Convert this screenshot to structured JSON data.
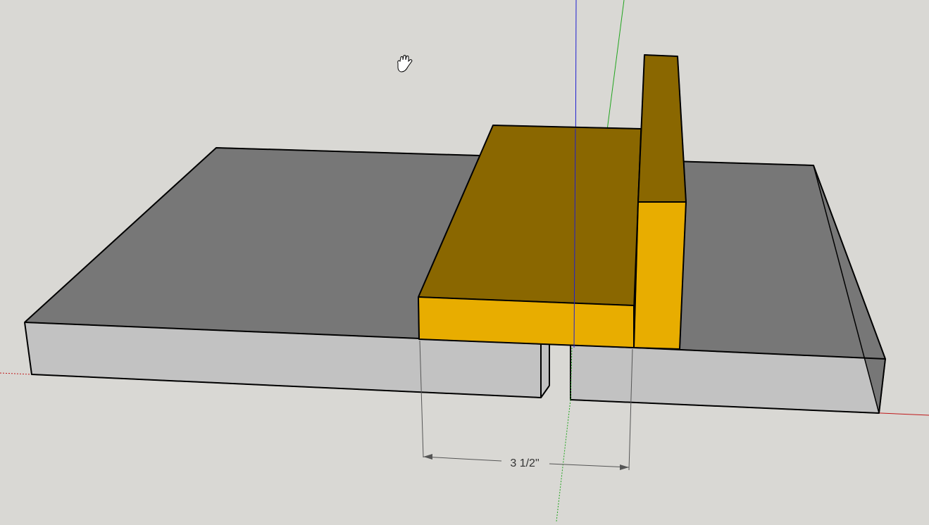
{
  "app": {
    "type": "3d-modeling-viewport"
  },
  "viewport": {
    "background_color": "#d9d8d4",
    "active_tool_icon": "pan-hand-icon"
  },
  "axes": {
    "red_color": "#c0191b",
    "green_color": "#22a51f",
    "blue_color": "#1f1fd0"
  },
  "model": {
    "board_top_color": "#777777",
    "board_side_color": "#c2c2c2",
    "jig_top_color": "#8a6700",
    "jig_front_color": "#e8ad00",
    "edge_color": "#000000"
  },
  "dimension": {
    "label": "3 1/2\"",
    "color": "#555555"
  }
}
